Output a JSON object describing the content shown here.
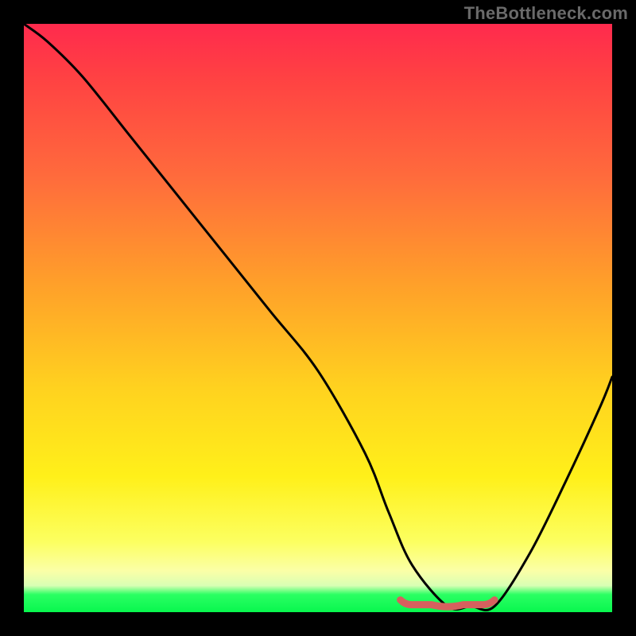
{
  "watermark": "TheBottleneck.com",
  "colors": {
    "page_bg": "#000000",
    "gradient_top": "#ff2a4d",
    "gradient_mid": "#ffd21f",
    "gradient_bottom": "#08f74e",
    "curve": "#000000",
    "trough_accent": "#d6605e"
  },
  "chart_data": {
    "type": "line",
    "title": "",
    "xlabel": "",
    "ylabel": "",
    "xlim": [
      0,
      100
    ],
    "ylim": [
      0,
      100
    ],
    "grid": false,
    "legend": false,
    "series": [
      {
        "name": "bottleneck-curve",
        "x": [
          0,
          4,
          10,
          18,
          26,
          34,
          42,
          50,
          58,
          62,
          66,
          72,
          76,
          80,
          86,
          92,
          98,
          100
        ],
        "values": [
          100,
          97,
          91,
          81,
          71,
          61,
          51,
          41,
          27,
          17,
          8,
          1,
          1,
          1,
          10,
          22,
          35,
          40
        ]
      }
    ],
    "annotations": [
      {
        "name": "trough-highlight",
        "x_start": 64,
        "x_end": 80,
        "y": 1
      }
    ]
  }
}
